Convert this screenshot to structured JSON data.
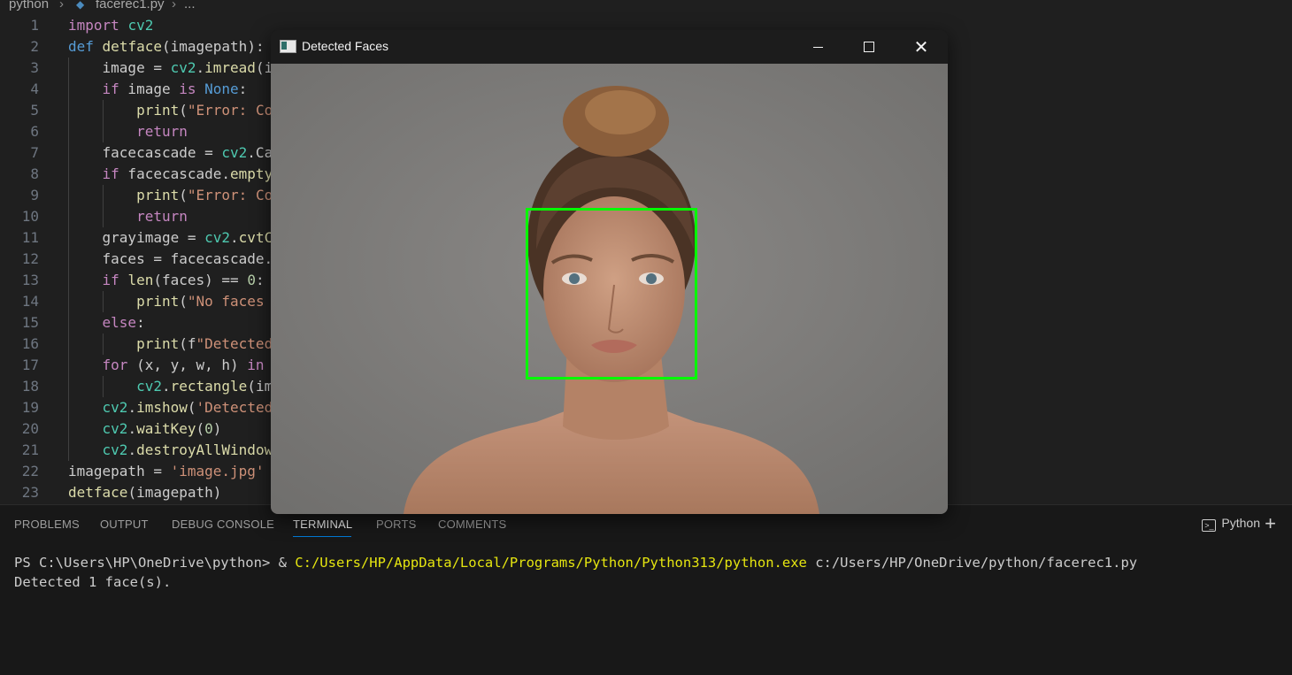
{
  "breadcrumb": {
    "folder": "python",
    "file": "facerec1.py",
    "more": "..."
  },
  "editor": {
    "lines": [
      {
        "n": "1",
        "t": "import cv2"
      },
      {
        "n": "2",
        "t": "def detface(imagepath):"
      },
      {
        "n": "3",
        "t": "    image = cv2.imread(i"
      },
      {
        "n": "4",
        "t": "    if image is None:"
      },
      {
        "n": "5",
        "t": "        print(\"Error: Co"
      },
      {
        "n": "6",
        "t": "        return"
      },
      {
        "n": "7",
        "t": "    facecascade = cv2.Ca"
      },
      {
        "n": "8",
        "t": "    if facecascade.empty"
      },
      {
        "n": "9",
        "t": "        print(\"Error: Co"
      },
      {
        "n": "10",
        "t": "        return"
      },
      {
        "n": "11",
        "t": "    grayimage = cv2.cvtC"
      },
      {
        "n": "12",
        "t": "    faces = facecascade."
      },
      {
        "n": "13",
        "t": "    if len(faces) == 0:"
      },
      {
        "n": "14",
        "t": "        print(\"No faces "
      },
      {
        "n": "15",
        "t": "    else:"
      },
      {
        "n": "16",
        "t": "        print(f\"Detected"
      },
      {
        "n": "17",
        "t": "    for (x, y, w, h) in "
      },
      {
        "n": "18",
        "t": "        cv2.rectangle(im"
      },
      {
        "n": "19",
        "t": "    cv2.imshow('Detected"
      },
      {
        "n": "20",
        "t": "    cv2.waitKey(0)"
      },
      {
        "n": "21",
        "t": "    cv2.destroyAllWindow"
      },
      {
        "n": "22",
        "t": "imagepath = 'image.jpg'"
      },
      {
        "n": "23",
        "t": "detface(imagepath)"
      }
    ]
  },
  "panel": {
    "tabs": [
      "PROBLEMS",
      "OUTPUT",
      "DEBUG CONSOLE",
      "TERMINAL",
      "PORTS",
      "COMMENTS"
    ],
    "active_tab": "TERMINAL",
    "terminal_name": "Python",
    "terminal": {
      "prompt": "PS C:\\Users\\HP\\OneDrive\\python> & ",
      "exe": "C:/Users/HP/AppData/Local/Programs/Python/Python313/python.exe",
      "arg": " c:/Users/HP/OneDrive/python/facerec1.py",
      "output": "Detected 1 face(s)."
    }
  },
  "window": {
    "title": "Detected Faces",
    "face_box_color": "#00ff00"
  },
  "colors": {
    "editor_bg": "#1f1f1f",
    "panel_bg": "#181818",
    "accent": "#0078d4"
  }
}
